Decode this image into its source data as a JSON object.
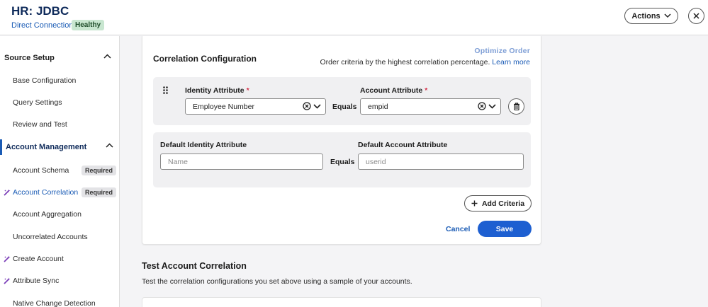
{
  "header": {
    "title": "HR: JDBC",
    "subtitle": "Direct Connection",
    "status_badge": "Healthy",
    "actions_label": "Actions"
  },
  "sidebar": {
    "sections": [
      {
        "label": "Source Setup",
        "items": [
          "Base Configuration",
          "Query Settings",
          "Review and Test"
        ]
      },
      {
        "label": "Account Management"
      }
    ],
    "items": [
      {
        "label": "Account Schema",
        "badge": "Required"
      },
      {
        "label": "Account Correlation",
        "badge": "Required"
      },
      {
        "label": "Account Aggregation"
      },
      {
        "label": "Uncorrelated Accounts"
      },
      {
        "label": "Create Account"
      },
      {
        "label": "Attribute Sync"
      },
      {
        "label": "Native Change Detection"
      }
    ]
  },
  "correlation": {
    "title": "Correlation Configuration",
    "optimize_label": "Optimize Order",
    "order_note": "Order criteria by the highest correlation percentage.",
    "learn_more": "Learn more",
    "criteria": {
      "identity_label": "Identity Attribute",
      "identity_value": "Employee Number",
      "equals": "Equals",
      "account_label": "Account Attribute",
      "account_value": "empid",
      "required_mark": "*"
    },
    "default": {
      "identity_label": "Default Identity Attribute",
      "identity_placeholder": "Name",
      "equals": "Equals",
      "account_label": "Default Account Attribute",
      "account_placeholder": "userid"
    },
    "add_criteria_label": "Add Criteria",
    "cancel_label": "Cancel",
    "save_label": "Save"
  },
  "test": {
    "title": "Test Account Correlation",
    "description": "Test the correlation configurations you set above using a sample of your accounts."
  },
  "colors": {
    "accent": "#1d5fd1",
    "link": "#1a5bb5",
    "required": "#d6334c",
    "healthy_bg": "#c8e6d0",
    "wand": "#7b3fb8"
  },
  "icons": [
    "chevron-down-icon",
    "close-icon",
    "chevron-up-icon",
    "magic-wand-icon",
    "drag-handle-icon",
    "clear-circle-icon",
    "trash-icon",
    "plus-icon"
  ]
}
